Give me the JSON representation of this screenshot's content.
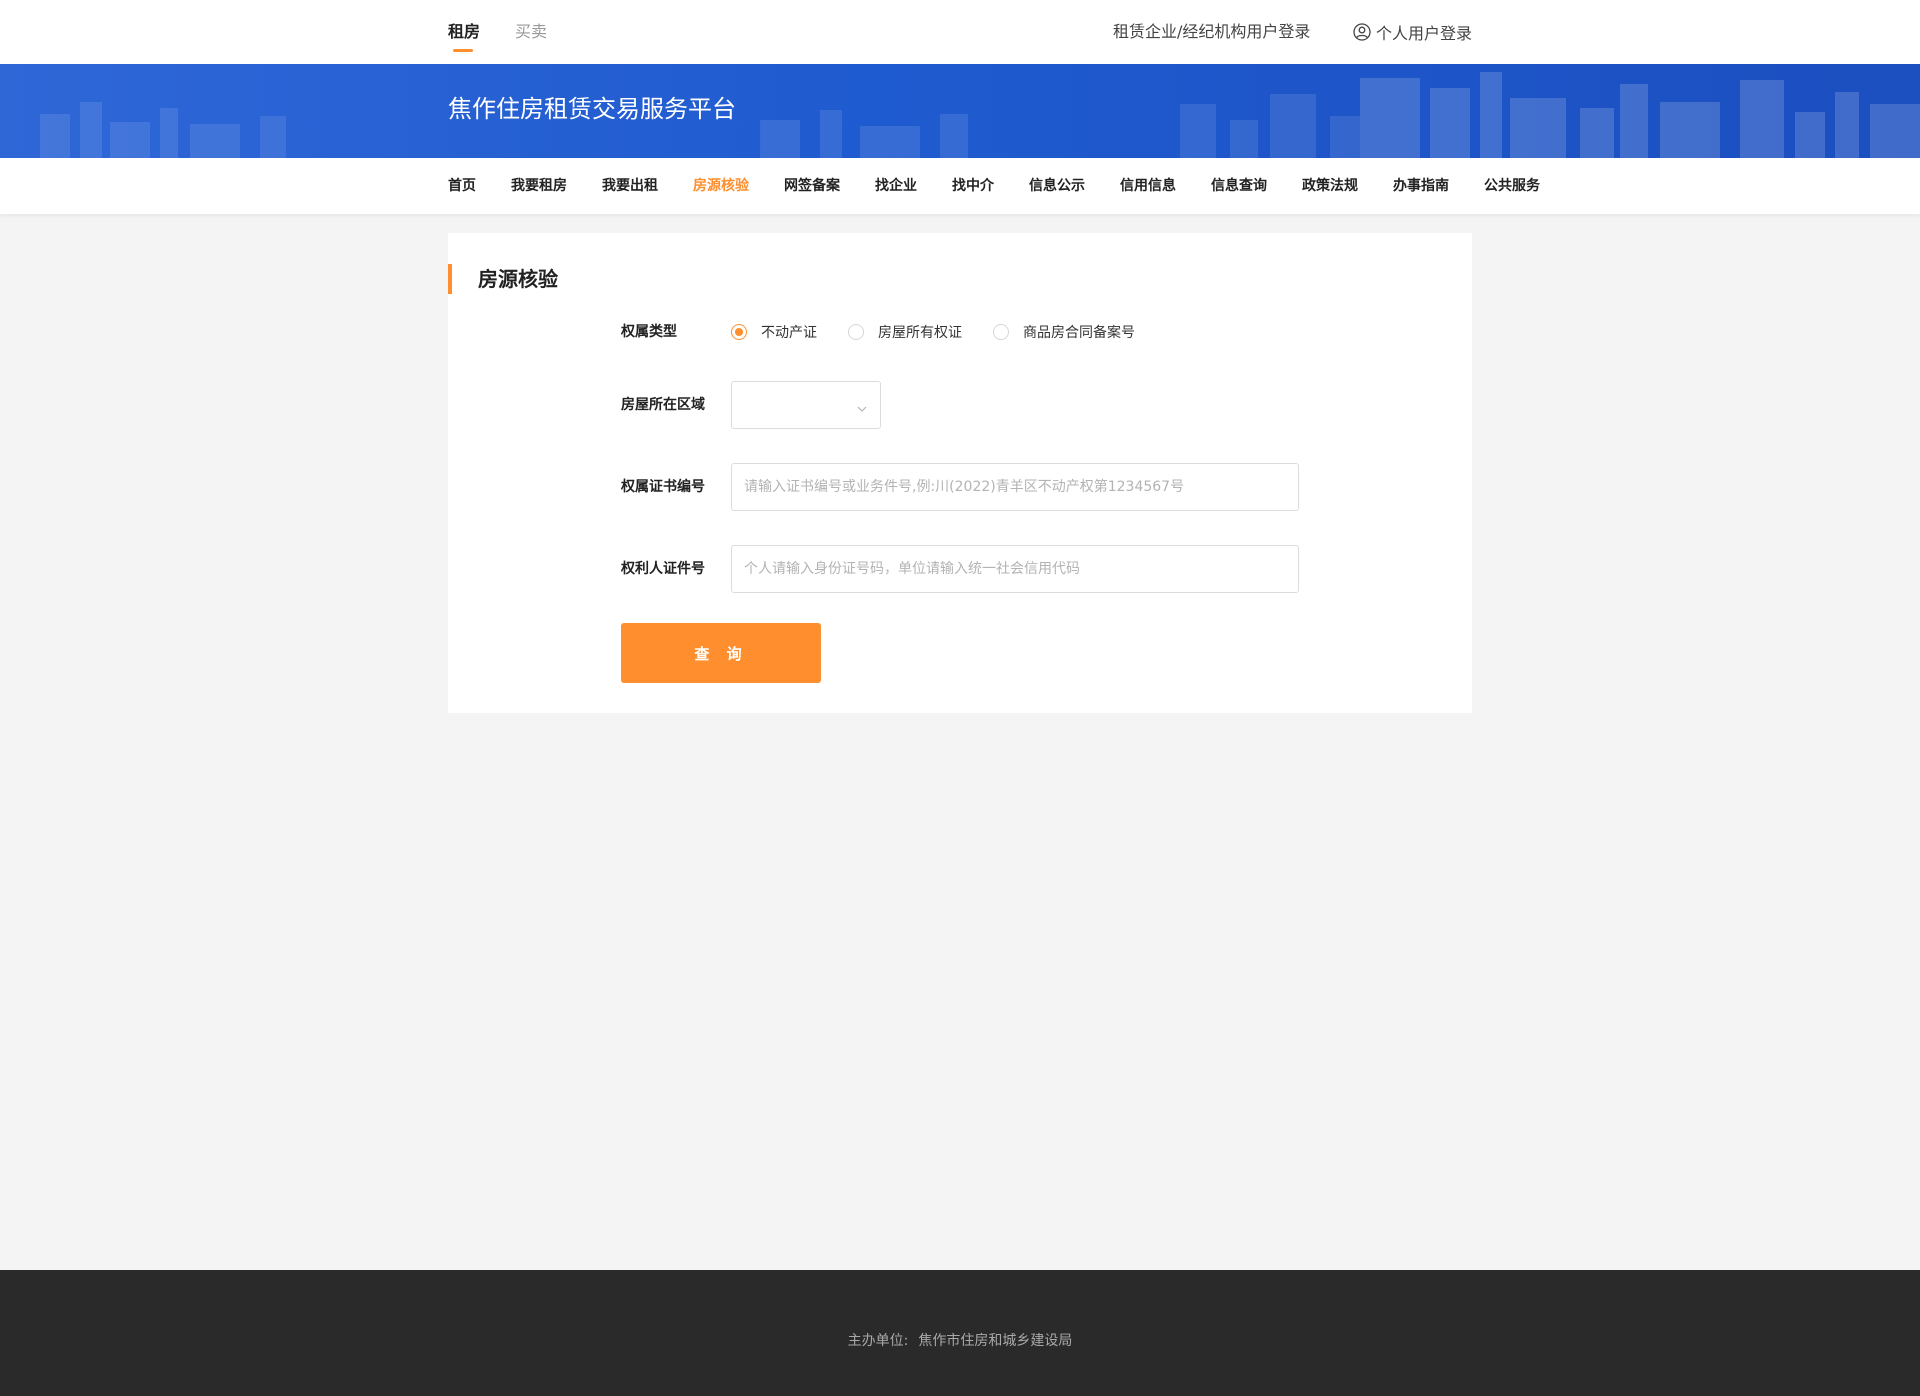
{
  "topbar": {
    "tabs": [
      {
        "label": "租房",
        "active": true
      },
      {
        "label": "买卖",
        "active": false
      }
    ],
    "org_login": "租赁企业/经纪机构用户登录",
    "person_login": "个人用户登录",
    "person_login_icon": "user-circle-icon"
  },
  "banner": {
    "title": "焦作住房租赁交易服务平台"
  },
  "nav": {
    "items": [
      {
        "label": "首页"
      },
      {
        "label": "我要租房"
      },
      {
        "label": "我要出租"
      },
      {
        "label": "房源核验",
        "active": true
      },
      {
        "label": "网签备案"
      },
      {
        "label": "找企业"
      },
      {
        "label": "找中介"
      },
      {
        "label": "信息公示"
      },
      {
        "label": "信用信息"
      },
      {
        "label": "信息查询"
      },
      {
        "label": "政策法规"
      },
      {
        "label": "办事指南"
      },
      {
        "label": "公共服务"
      }
    ]
  },
  "form": {
    "title": "房源核验",
    "ownership_type_label": "权属类型",
    "ownership_options": [
      {
        "label": "不动产证",
        "checked": true
      },
      {
        "label": "房屋所有权证",
        "checked": false
      },
      {
        "label": "商品房合同备案号",
        "checked": false
      }
    ],
    "region_label": "房屋所在区域",
    "region_value": "",
    "cert_no_label": "权属证书编号",
    "cert_no_placeholder": "请输入证书编号或业务件号,例:川(2022)青羊区不动产权第1234567号",
    "owner_id_label": "权利人证件号",
    "owner_id_placeholder": "个人请输入身份证号码，单位请输入统一社会信用代码",
    "query_button": "查 询"
  },
  "footer": {
    "host_label": "主办单位:",
    "host_value": "焦作市住房和城乡建设局"
  },
  "colors": {
    "accent": "#ff8f2e",
    "banner_blue": "#2160d4",
    "footer_bg": "#2a2a2a",
    "page_bg": "#f4f4f4"
  }
}
